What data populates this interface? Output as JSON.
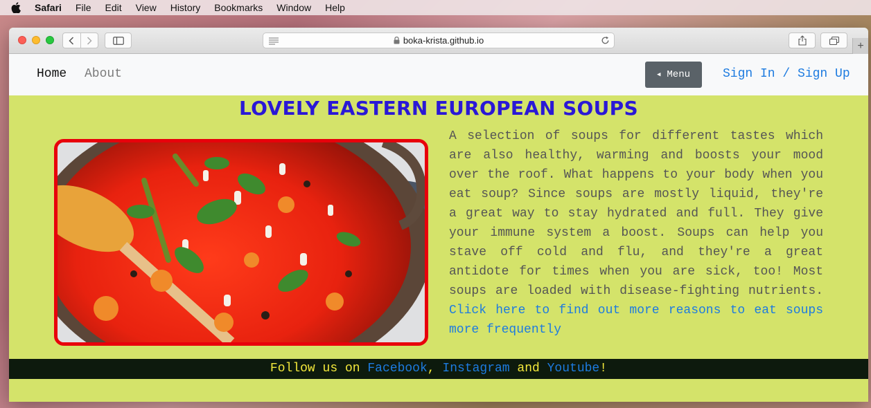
{
  "menubar": {
    "items": [
      "Safari",
      "File",
      "Edit",
      "View",
      "History",
      "Bookmarks",
      "Window",
      "Help"
    ]
  },
  "browser": {
    "url": "boka-krista.github.io",
    "newtab": "+"
  },
  "nav": {
    "home": "Home",
    "about": "About",
    "menu": "Menu",
    "signin": "Sign In / Sign Up"
  },
  "page": {
    "title": "LOVELY EASTERN EUROPEAN SOUPS",
    "paragraph": "A selection of soups for different tastes which are also healthy, warming and boosts your mood over the roof. What happens to your body when you eat soup? Since soups are mostly liquid, they're a great way to stay hydrated and full. They give your immune system a boost. Soups can help you stave off cold and flu, and they're a great antidote for times when you are sick, too! Most soups are loaded with disease-fighting nutrients. ",
    "link": "Click here to find out more reasons to eat soups more frequently"
  },
  "footer": {
    "prefix": "Follow us on ",
    "facebook": "Facebook",
    "sep1": ", ",
    "instagram": "Instagram",
    "sep2": " and ",
    "youtube": "Youtube",
    "suffix": "!"
  },
  "colors": {
    "page_bg": "#d4e36a",
    "title": "#2a18d6",
    "link": "#1d7be0",
    "footer_bg": "#0d1a0d",
    "footer_text": "#f4e93b",
    "image_border": "#e8000b"
  }
}
